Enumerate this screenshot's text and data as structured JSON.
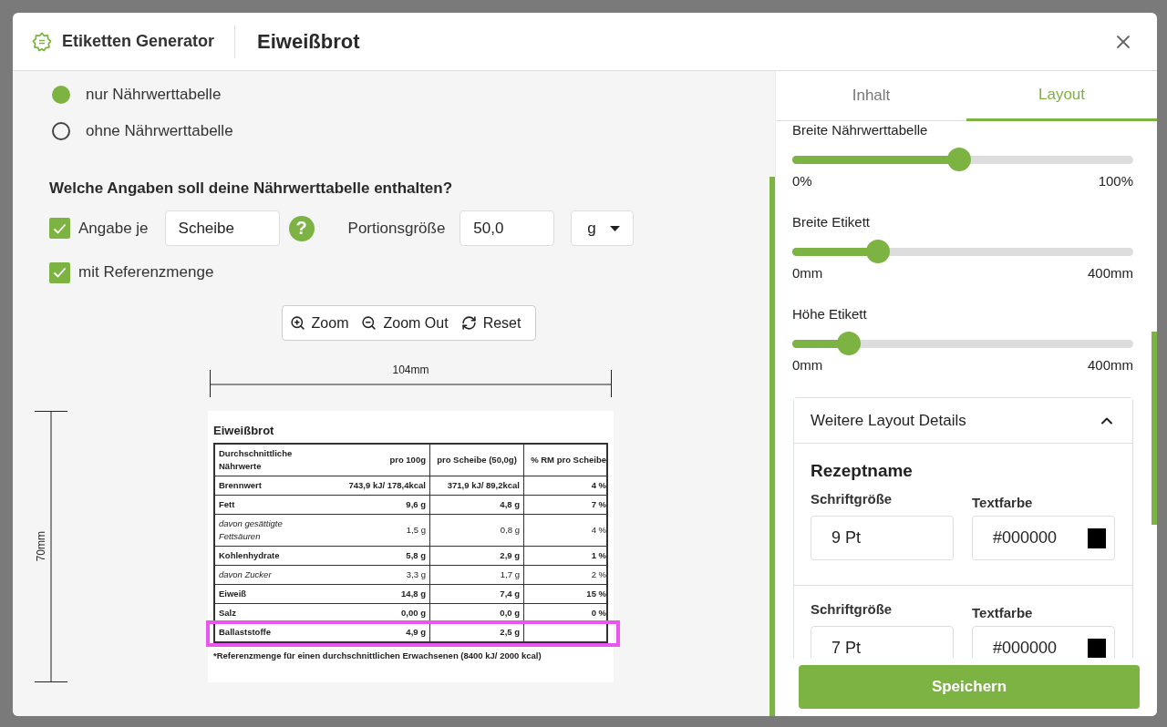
{
  "dialog": {
    "app_name": "Etiketten Generator",
    "title": "Eiweißbrot"
  },
  "display_options": [
    {
      "label": "nur Nährwerttabelle",
      "selected": true
    },
    {
      "label": "ohne Nährwerttabelle",
      "selected": false
    }
  ],
  "contents": {
    "heading": "Welche Angaben soll deine Nährwerttabelle enthalten?",
    "per_unit": {
      "label": "Angabe je",
      "checked": true,
      "value": "Scheibe"
    },
    "help": "?",
    "portion_size": {
      "label": "Portionsgröße",
      "value": "50,0"
    },
    "unit": "g",
    "reference_amount": {
      "label": "mit Referenzmenge",
      "checked": true
    }
  },
  "zoom_toolbar": [
    {
      "kind": "zoom-in",
      "label": "Zoom"
    },
    {
      "kind": "zoom-out",
      "label": "Zoom Out"
    },
    {
      "kind": "reset",
      "label": "Reset"
    }
  ],
  "preview": {
    "width": "104mm",
    "height": "70mm",
    "recipe_name": "Eiweißbrot",
    "columns": [
      "Durchschnittliche Nährwerte",
      "pro 100g",
      "pro Scheibe (50,0g)",
      "% RM pro Scheibe"
    ],
    "rows": [
      {
        "kind": "main",
        "name": "Brennwert",
        "per_100g": "743,9 kJ/ 178,4kcal",
        "per_portion": "371,9 kJ/ 89,2kcal",
        "reference_share": "4 %",
        "highlighted": false
      },
      {
        "kind": "main",
        "name": "Fett",
        "per_100g": "9,6 g",
        "per_portion": "4,8 g",
        "reference_share": "7 %",
        "highlighted": false
      },
      {
        "kind": "sub",
        "name": "davon gesättigte Fettsäuren",
        "per_100g": "1,5 g",
        "per_portion": "0,8 g",
        "reference_share": "4 %",
        "highlighted": false
      },
      {
        "kind": "main",
        "name": "Kohlenhydrate",
        "per_100g": "5,8 g",
        "per_portion": "2,9 g",
        "reference_share": "1 %",
        "highlighted": false
      },
      {
        "kind": "sub",
        "name": "davon Zucker",
        "per_100g": "3,3 g",
        "per_portion": "1,7 g",
        "reference_share": "2 %",
        "highlighted": false
      },
      {
        "kind": "main",
        "name": "Eiweiß",
        "per_100g": "14,8 g",
        "per_portion": "7,4 g",
        "reference_share": "15 %",
        "highlighted": false
      },
      {
        "kind": "main",
        "name": "Salz",
        "per_100g": "0,00 g",
        "per_portion": "0,0 g",
        "reference_share": "0 %",
        "highlighted": false
      },
      {
        "kind": "main",
        "name": "Ballaststoffe",
        "per_100g": "4,9 g",
        "per_portion": "2,5 g",
        "highlighted": true
      }
    ],
    "footnote": "*Referenzmenge für einen durchschnittlichen Erwachsenen (8400 kJ/ 2000 kcal)"
  },
  "tabs": [
    {
      "label": "Inhalt",
      "selected": false
    },
    {
      "label": "Layout",
      "selected": true
    }
  ],
  "sliders": [
    {
      "label": "Breite Nährwerttabelle",
      "level": 0.49,
      "min_label": "0%",
      "max_label": "100%"
    },
    {
      "label": "Breite Etikett",
      "level": 0.25,
      "min_label": "0mm",
      "max_label": "400mm"
    },
    {
      "label": "Höhe Etikett",
      "level": 0.165,
      "min_label": "0mm",
      "max_label": "400mm"
    }
  ],
  "layout_details": {
    "title": "Weitere Layout Details",
    "expanded": true,
    "groups": [
      {
        "heading": "Rezeptname",
        "font_size_label": "Schriftgröße",
        "font_size": "9 Pt",
        "color_label": "Textfarbe",
        "color_value": "#000000",
        "color": "#000000"
      },
      {
        "font_size_label": "Schriftgröße",
        "font_size": "7 Pt",
        "color_label": "Textfarbe",
        "color_value": "#000000",
        "color": "#000000"
      }
    ]
  },
  "save_button": "Speichern"
}
